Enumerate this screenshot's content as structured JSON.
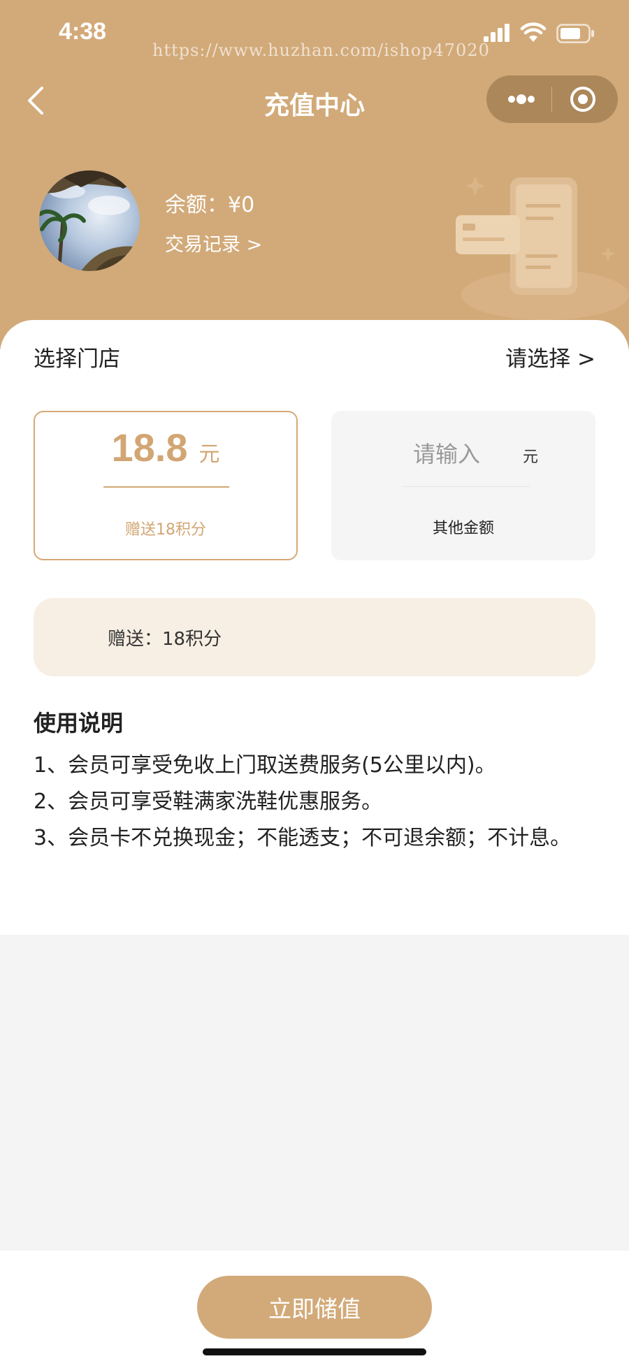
{
  "status_bar": {
    "time": "4:38",
    "watermark": "https://www.huzhan.com/ishop47020"
  },
  "nav": {
    "title": "充值中心",
    "back_icon": "chevron-left-icon",
    "menu_icon": "more-dots-icon",
    "close_icon": "target-circle-icon"
  },
  "profile": {
    "balance": "余额：¥0",
    "trade_link": "交易记录 >"
  },
  "store": {
    "label": "选择门店",
    "value": "请选择 >"
  },
  "amount_option": {
    "value": "18.8",
    "unit": "元",
    "gift": "赠送18积分"
  },
  "custom_amount": {
    "placeholder": "请输入",
    "value": "",
    "unit": "元",
    "label": "其他金额"
  },
  "gift_banner": {
    "text": "赠送：18积分"
  },
  "instructions": {
    "title": "使用说明",
    "items": [
      "1、会员可享受免收上门取送费服务(5公里以内)。",
      "2、会员可享受鞋满家洗鞋优惠服务。",
      "3、会员卡不兑换现金；不能透支；不可退余额；不计息。"
    ]
  },
  "bottom": {
    "button_label": "立即储值"
  },
  "colors": {
    "brand": "#d2aa79",
    "accent_text": "#d2a673",
    "gift_bg": "#f7efe3"
  }
}
